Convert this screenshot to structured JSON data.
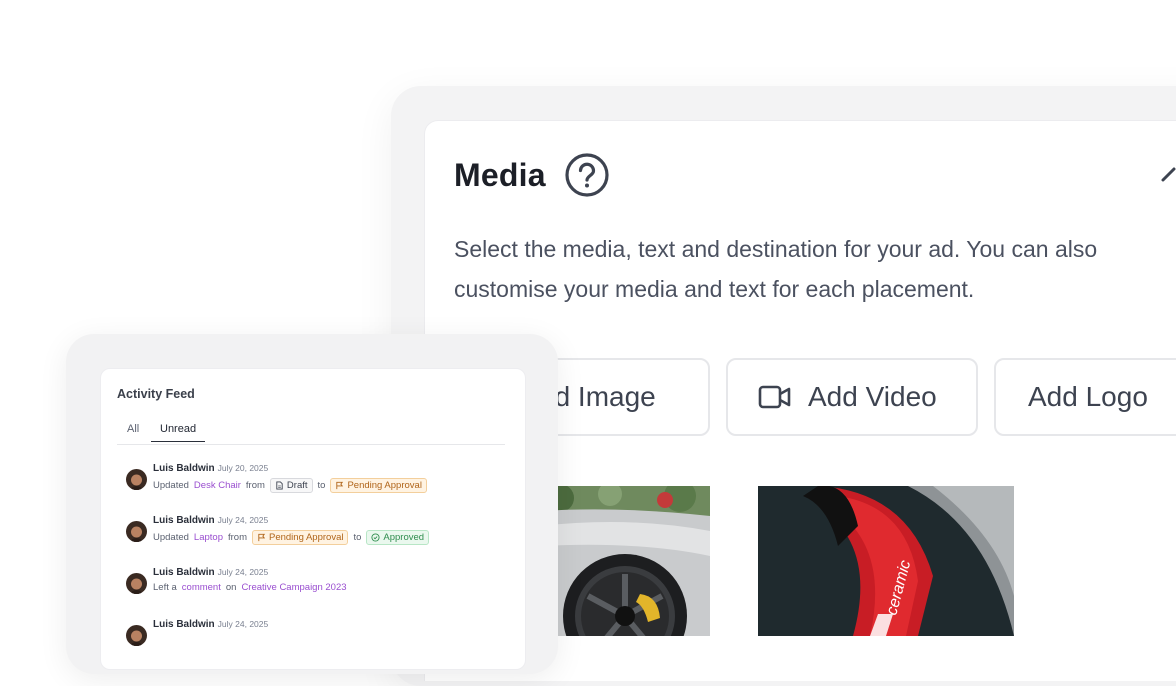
{
  "media": {
    "title": "Media",
    "description": "Select the media, text and destination for your ad. You can also customise your media and text for each placement.",
    "buttons": {
      "image": "dd Image",
      "video": "Add Video",
      "logo": "Add Logo"
    }
  },
  "feed": {
    "title": "Activity Feed",
    "tabs": {
      "all": "All",
      "unread": "Unread"
    },
    "entries": [
      {
        "name": "Luis Baldwin",
        "date": "July 20, 2025",
        "verb": "Updated",
        "item": "Desk Chair",
        "from_word": "from",
        "from_status": "Draft",
        "to_word": "to",
        "to_status": "Pending Approval"
      },
      {
        "name": "Luis Baldwin",
        "date": "July 24, 2025",
        "verb": "Updated",
        "item": "Laptop",
        "from_word": "from",
        "from_status": "Pending Approval",
        "to_word": "to",
        "to_status": "Approved"
      },
      {
        "name": "Luis Baldwin",
        "date": "July 24, 2025",
        "verb": "Left a",
        "item": "comment",
        "on_word": "on",
        "target": "Creative Campaign 2023"
      },
      {
        "name": "Luis Baldwin",
        "date": "July 24, 2025"
      }
    ]
  },
  "colors": {
    "link": "#9a4fd0",
    "pending": "#b0651a",
    "approved": "#2f8d4e"
  }
}
